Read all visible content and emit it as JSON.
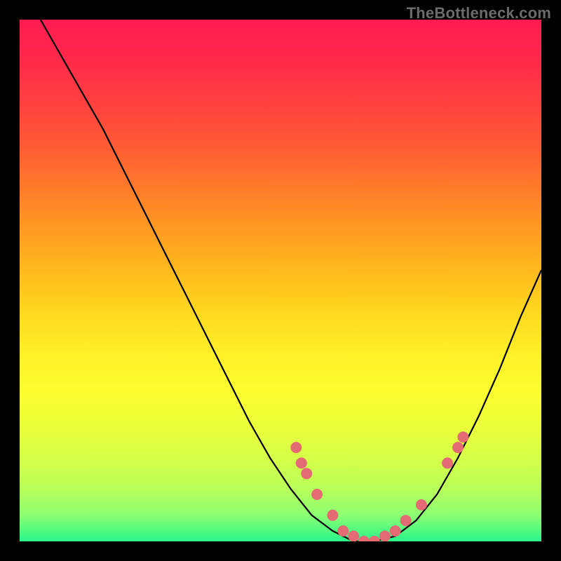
{
  "watermark": "TheBottleneck.com",
  "colors": {
    "frame_bg": "#000000",
    "dot_fill": "#e46a73",
    "curve_stroke": "#000000",
    "gradient_top": "#ff1a52",
    "gradient_bottom": "#28f58a"
  },
  "chart_data": {
    "type": "line",
    "title": "",
    "xlabel": "",
    "ylabel": "",
    "xlim": [
      0,
      100
    ],
    "ylim": [
      0,
      100
    ],
    "grid": false,
    "legend": false,
    "curve": [
      {
        "x": 4,
        "y": 100
      },
      {
        "x": 8,
        "y": 93
      },
      {
        "x": 12,
        "y": 86
      },
      {
        "x": 16,
        "y": 79
      },
      {
        "x": 20,
        "y": 71
      },
      {
        "x": 24,
        "y": 63
      },
      {
        "x": 28,
        "y": 55
      },
      {
        "x": 32,
        "y": 47
      },
      {
        "x": 36,
        "y": 39
      },
      {
        "x": 40,
        "y": 31
      },
      {
        "x": 44,
        "y": 23
      },
      {
        "x": 48,
        "y": 16
      },
      {
        "x": 52,
        "y": 10
      },
      {
        "x": 56,
        "y": 5
      },
      {
        "x": 60,
        "y": 2
      },
      {
        "x": 64,
        "y": 0
      },
      {
        "x": 68,
        "y": 0
      },
      {
        "x": 72,
        "y": 1
      },
      {
        "x": 76,
        "y": 4
      },
      {
        "x": 80,
        "y": 9
      },
      {
        "x": 84,
        "y": 16
      },
      {
        "x": 88,
        "y": 24
      },
      {
        "x": 92,
        "y": 33
      },
      {
        "x": 96,
        "y": 43
      },
      {
        "x": 100,
        "y": 52
      }
    ],
    "markers": [
      {
        "x": 53,
        "y": 18
      },
      {
        "x": 54,
        "y": 15
      },
      {
        "x": 55,
        "y": 13
      },
      {
        "x": 57,
        "y": 9
      },
      {
        "x": 60,
        "y": 5
      },
      {
        "x": 62,
        "y": 2
      },
      {
        "x": 64,
        "y": 1
      },
      {
        "x": 66,
        "y": 0
      },
      {
        "x": 68,
        "y": 0
      },
      {
        "x": 70,
        "y": 1
      },
      {
        "x": 72,
        "y": 2
      },
      {
        "x": 74,
        "y": 4
      },
      {
        "x": 77,
        "y": 7
      },
      {
        "x": 82,
        "y": 15
      },
      {
        "x": 84,
        "y": 18
      },
      {
        "x": 85,
        "y": 20
      }
    ]
  }
}
